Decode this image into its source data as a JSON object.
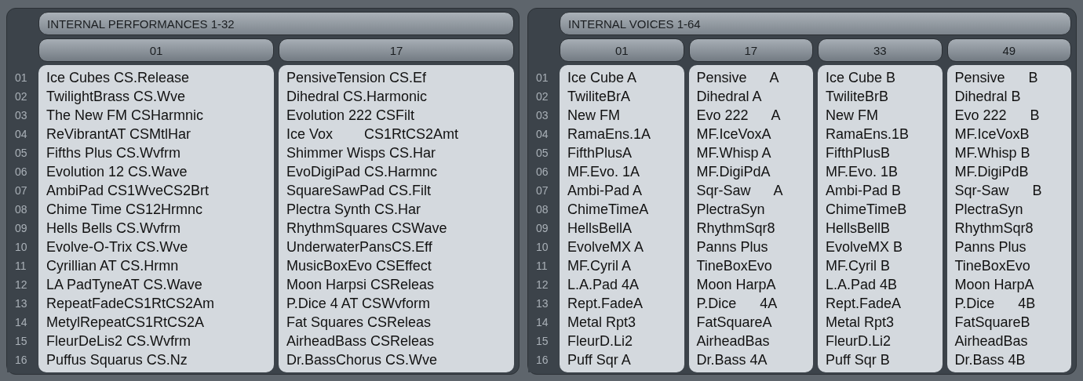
{
  "panels": [
    {
      "title": "INTERNAL PERFORMANCES 1-32",
      "row_numbers": [
        "01",
        "02",
        "03",
        "04",
        "05",
        "06",
        "07",
        "08",
        "09",
        "10",
        "11",
        "12",
        "13",
        "14",
        "15",
        "16"
      ],
      "columns": [
        {
          "header": "01",
          "items": [
            "Ice Cubes CS.Release",
            "TwilightBrass CS.Wve",
            "The New FM CSHarmnic",
            "ReVibrantAT CSMtlHar",
            "Fifths Plus CS.Wvfrm",
            "Evolution 12 CS.Wave",
            "AmbiPad CS1WveCS2Brt",
            "Chime Time CS12Hrmnc",
            "Hells Bells CS.Wvfrm",
            "Evolve-O-Trix CS.Wve",
            "Cyrillian AT CS.Hrmn",
            "LA PadTyneAT CS.Wave",
            "RepeatFadeCS1RtCS2Am",
            "MetylRepeatCS1RtCS2A",
            "FleurDeLis2 CS.Wvfrm",
            "Puffus Squarus CS.Nz"
          ]
        },
        {
          "header": "17",
          "items": [
            "PensiveTension CS.Ef",
            "Dihedral CS.Harmonic",
            "Evolution 222 CSFilt",
            "Ice Vox        CS1RtCS2Amt",
            "Shimmer Wisps CS.Har",
            "EvoDigiPad CS.Harmnc",
            "SquareSawPad CS.Filt",
            "Plectra Synth CS.Har",
            "RhythmSquares CSWave",
            "UnderwaterPansCS.Eff",
            "MusicBoxEvo CSEffect",
            "Moon Harpsi CSReleas",
            "P.Dice 4 AT CSWvform",
            "Fat Squares CSReleas",
            "AirheadBass CSReleas",
            "Dr.BassChorus CS.Wve"
          ]
        }
      ]
    },
    {
      "title": "INTERNAL VOICES 1-64",
      "row_numbers": [
        "01",
        "02",
        "03",
        "04",
        "05",
        "06",
        "07",
        "08",
        "09",
        "10",
        "11",
        "12",
        "13",
        "14",
        "15",
        "16"
      ],
      "columns": [
        {
          "header": "01",
          "items": [
            "Ice Cube A",
            "TwiliteBrA",
            "New FM",
            "RamaEns.1A",
            "FifthPlusA",
            "MF.Evo. 1A",
            "Ambi-Pad A",
            "ChimeTimeA",
            "HellsBellA",
            "EvolveMX A",
            "MF.Cyril A",
            "L.A.Pad 4A",
            "Rept.FadeA",
            "Metal Rpt3",
            "FleurD.Li2",
            "Puff Sqr A"
          ]
        },
        {
          "header": "17",
          "items": [
            "Pensive      A",
            "Dihedral A",
            "Evo 222      A",
            "MF.IceVoxA",
            "MF.Whisp A",
            "MF.DigiPdA",
            "Sqr-Saw      A",
            "PlectraSyn",
            "RhythmSqr8",
            "Panns Plus",
            "TineBoxEvo",
            "Moon HarpA",
            "P.Dice      4A",
            "FatSquareA",
            "AirheadBas",
            "Dr.Bass 4A"
          ]
        },
        {
          "header": "33",
          "items": [
            "Ice Cube B",
            "TwiliteBrB",
            "New FM",
            "RamaEns.1B",
            "FifthPlusB",
            "MF.Evo. 1B",
            "Ambi-Pad B",
            "ChimeTimeB",
            "HellsBellB",
            "EvolveMX B",
            "MF.Cyril B",
            "L.A.Pad 4B",
            "Rept.FadeA",
            "Metal Rpt3",
            "FleurD.Li2",
            "Puff Sqr B"
          ]
        },
        {
          "header": "49",
          "items": [
            "Pensive      B",
            "Dihedral B",
            "Evo 222      B",
            "MF.IceVoxB",
            "MF.Whisp B",
            "MF.DigiPdB",
            "Sqr-Saw      B",
            "PlectraSyn",
            "RhythmSqr8",
            "Panns Plus",
            "TineBoxEvo",
            "Moon HarpA",
            "P.Dice      4B",
            "FatSquareB",
            "AirheadBas",
            "Dr.Bass 4B"
          ]
        }
      ]
    }
  ]
}
